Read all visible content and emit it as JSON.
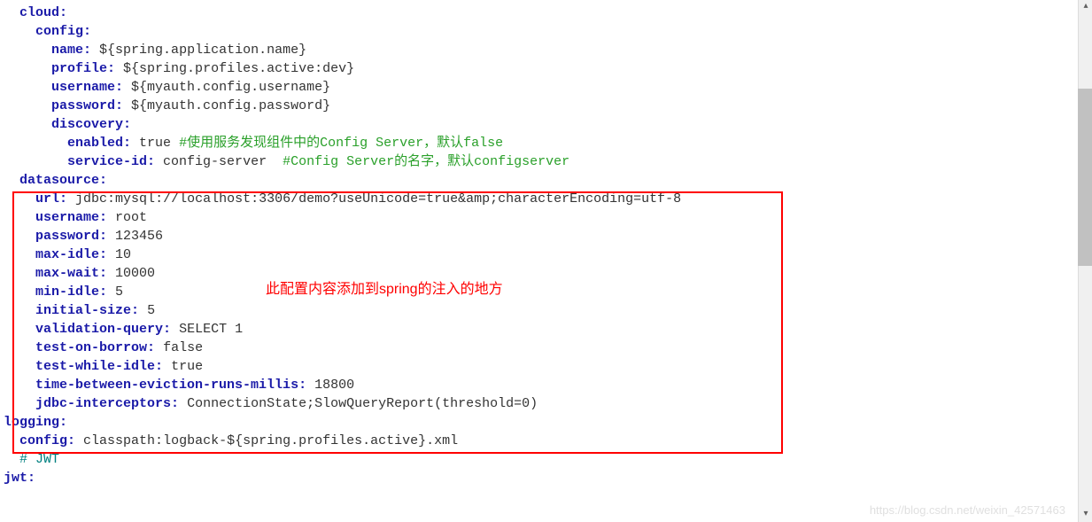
{
  "annotation": "此配置内容添加到spring的注入的地方",
  "watermark": "https://blog.csdn.net/weixin_42571463",
  "yaml": {
    "cloud": {
      "key": "cloud",
      "config": {
        "key": "config",
        "name": {
          "key": "name",
          "value": " ${spring.application.name}"
        },
        "profile": {
          "key": "profile",
          "value": " ${spring.profiles.active:dev}"
        },
        "username": {
          "key": "username",
          "value": " ${myauth.config.username}"
        },
        "password": {
          "key": "password",
          "value": " ${myauth.config.password}"
        },
        "discovery": {
          "key": "discovery",
          "enabled": {
            "key": "enabled",
            "value": " true ",
            "comment": "#使用服务发现组件中的Config Server，默认false"
          },
          "serviceid": {
            "key": "service-id",
            "value": " config-server  ",
            "comment": "#Config Server的名字，默认configserver"
          }
        }
      }
    },
    "datasource": {
      "key": "datasource",
      "url": {
        "key": "url",
        "value": " jdbc:mysql://localhost:3306/demo?useUnicode=true&amp;characterEncoding=utf-8"
      },
      "username": {
        "key": "username",
        "value": " root"
      },
      "password": {
        "key": "password",
        "value": " 123456"
      },
      "maxidle": {
        "key": "max-idle",
        "value": " 10"
      },
      "maxwait": {
        "key": "max-wait",
        "value": " 10000"
      },
      "minidle": {
        "key": "min-idle",
        "value": " 5"
      },
      "initialsize": {
        "key": "initial-size",
        "value": " 5"
      },
      "validationquery": {
        "key": "validation-query",
        "value": " SELECT 1"
      },
      "testonborrow": {
        "key": "test-on-borrow",
        "value": " false"
      },
      "testwhileidle": {
        "key": "test-while-idle",
        "value": " true"
      },
      "tbetween": {
        "key": "time-between-eviction-runs-millis",
        "value": " 18800"
      },
      "interceptors": {
        "key": "jdbc-interceptors",
        "value": " ConnectionState;SlowQueryReport(threshold=0)"
      }
    },
    "logging": {
      "key": "logging",
      "config": {
        "key": "config",
        "value": " classpath:logback-${spring.profiles.active}.xml"
      },
      "jwtcomment": "# JWT"
    },
    "jwt": {
      "key": "jwt"
    }
  }
}
